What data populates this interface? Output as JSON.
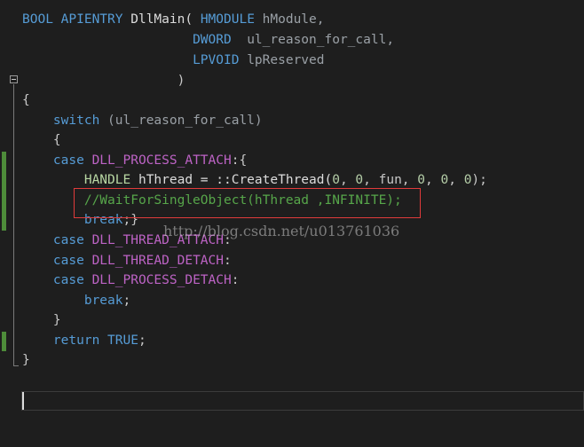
{
  "lines": {
    "l1": {
      "t1": "BOOL",
      "t2": "APIENTRY",
      "t3": "DllMain(",
      "t4": "HMODULE",
      "t5": "hModule,",
      "indent": ""
    },
    "l2": {
      "t1": "DWORD",
      "t2": "ul_reason_for_call,",
      "indent": "                      "
    },
    "l3": {
      "t1": "LPVOID",
      "t2": "lpReserved",
      "indent": "                      "
    },
    "l4": {
      "t1": ")",
      "indent": "                    "
    },
    "l5": {
      "t1": "{"
    },
    "l6": {
      "t1": "switch",
      "t2": "(ul_reason_for_call)",
      "indent": "    "
    },
    "l7": {
      "t1": "{",
      "indent": "    "
    },
    "l8": {
      "t1": "case",
      "t2": "DLL_PROCESS_ATTACH",
      "t3": ":{",
      "indent": "    "
    },
    "l9": {
      "t1": "HANDLE",
      "t2": "hThread = ::CreateThread(",
      "t3": "0",
      "t4": ",",
      "t5": "0",
      "t6": ", fun,",
      "t7": "0",
      "t8": ",",
      "t9": "0",
      "t10": ",",
      "t11": "0",
      "t12": ");",
      "indent": "        "
    },
    "l10": {
      "t1": "//WaitForSingleObject(hThread ,INFINITE);",
      "indent": "        "
    },
    "l11": {
      "t1": "break",
      "t2": ";}",
      "indent": "        "
    },
    "l12": {
      "t1": "case",
      "t2": "DLL_THREAD_ATTACH",
      "t3": ":",
      "indent": "    "
    },
    "l13": {
      "t1": "case",
      "t2": "DLL_THREAD_DETACH",
      "t3": ":",
      "indent": "    "
    },
    "l14": {
      "t1": "case",
      "t2": "DLL_PROCESS_DETACH",
      "t3": ":",
      "indent": "    "
    },
    "l15": {
      "t1": "break",
      "t2": ";",
      "indent": "        "
    },
    "l16": {
      "t1": "}",
      "indent": "    "
    },
    "l17": {
      "t1": "return",
      "t2": "TRUE",
      "t3": ";",
      "indent": "    "
    },
    "l18": {
      "t1": "}"
    }
  },
  "watermark": "http://blog.csdn.net/u013761036",
  "colors": {
    "background": "#1e1e1e",
    "keyword": "#569cd6",
    "type": "#b8d7a3",
    "macro": "#bd63c5",
    "number": "#b5cea8",
    "comment": "#57a64a",
    "highlight_border": "#e03b3b",
    "change_bar": "#4e8c3a"
  }
}
